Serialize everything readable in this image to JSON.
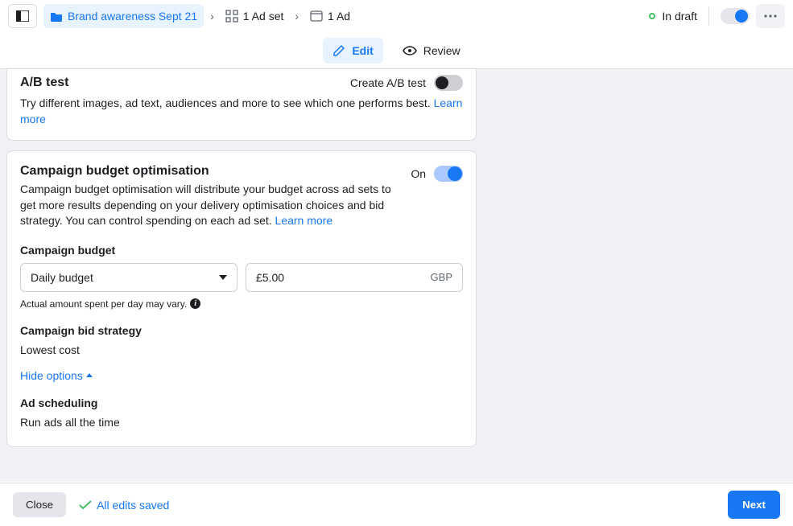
{
  "topbar": {
    "campaign": "Brand awareness Sept 21",
    "adset": "1 Ad set",
    "ad": "1 Ad",
    "status": "In draft"
  },
  "tabs": {
    "edit": "Edit",
    "review": "Review"
  },
  "ab": {
    "title": "A/B test",
    "toggle_label": "Create A/B test",
    "desc": "Try different images, ad text, audiences and more to see which one performs best. ",
    "learn": "Learn more"
  },
  "cbo": {
    "title": "Campaign budget optimisation",
    "on": "On",
    "desc": "Campaign budget optimisation will distribute your budget across ad sets to get more results depending on your delivery optimisation choices and bid strategy. You can control spending on each ad set. ",
    "learn": "Learn more",
    "budget_label": "Campaign budget",
    "budget_type": "Daily budget",
    "budget_value": "£5.00",
    "currency": "GBP",
    "hint": "Actual amount spent per day may vary.",
    "bid_label": "Campaign bid strategy",
    "bid_value": "Lowest cost",
    "hide": "Hide options",
    "sched_label": "Ad scheduling",
    "sched_value": "Run ads all the time"
  },
  "bottom": {
    "close": "Close",
    "saved": "All edits saved",
    "next": "Next"
  }
}
